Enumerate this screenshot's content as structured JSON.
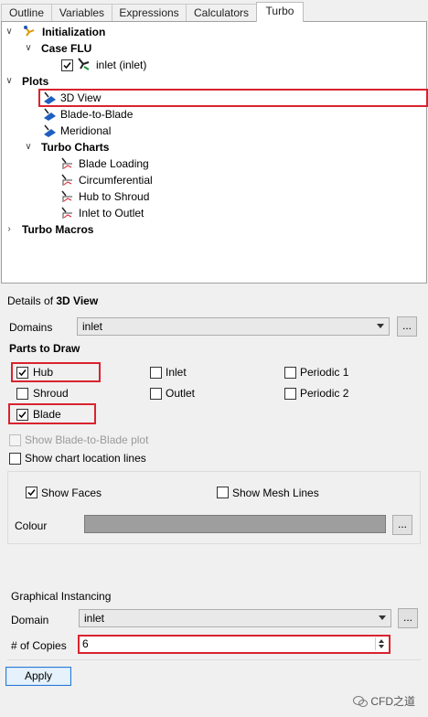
{
  "tabs": [
    "Outline",
    "Variables",
    "Expressions",
    "Calculators",
    "Turbo"
  ],
  "active_tab": "Turbo",
  "tree": {
    "initialization": "Initialization",
    "case_flu": "Case FLU",
    "inlet_item": "inlet (inlet)",
    "plots": "Plots",
    "view3d": "3D View",
    "blade_to_blade": "Blade-to-Blade",
    "meridional": "Meridional",
    "turbo_charts": "Turbo Charts",
    "blade_loading": "Blade Loading",
    "circumferential": "Circumferential",
    "hub_to_shroud": "Hub to Shroud",
    "inlet_to_outlet": "Inlet to Outlet",
    "turbo_macros": "Turbo Macros"
  },
  "details": {
    "title_prefix": "Details of ",
    "title_object": "3D View",
    "domains_label": "Domains",
    "domains_value": "inlet",
    "dots_label": "...",
    "parts_heading": "Parts to Draw",
    "parts": {
      "hub": {
        "label": "Hub",
        "checked": true
      },
      "inlet": {
        "label": "Inlet",
        "checked": false
      },
      "periodic1": {
        "label": "Periodic 1",
        "checked": false
      },
      "shroud": {
        "label": "Shroud",
        "checked": false
      },
      "outlet": {
        "label": "Outlet",
        "checked": false
      },
      "periodic2": {
        "label": "Periodic 2",
        "checked": false
      },
      "blade": {
        "label": "Blade",
        "checked": true
      }
    },
    "show_b2b_plot": "Show Blade-to-Blade plot",
    "show_chart_lines": "Show chart location lines",
    "show_faces": "Show Faces",
    "show_mesh_lines": "Show Mesh Lines",
    "colour_label": "Colour",
    "colour_value": "#9e9e9e",
    "instancing_heading": "Graphical Instancing",
    "domain_label": "Domain",
    "domain_value": "inlet",
    "copies_label": "# of Copies",
    "copies_value": "6",
    "apply_label": "Apply"
  },
  "watermark": "CFD之道",
  "colors": {
    "highlight_red": "#d9232e",
    "apply_border": "#2a78d6",
    "tree_icon_blue": "#1f5fbf"
  }
}
